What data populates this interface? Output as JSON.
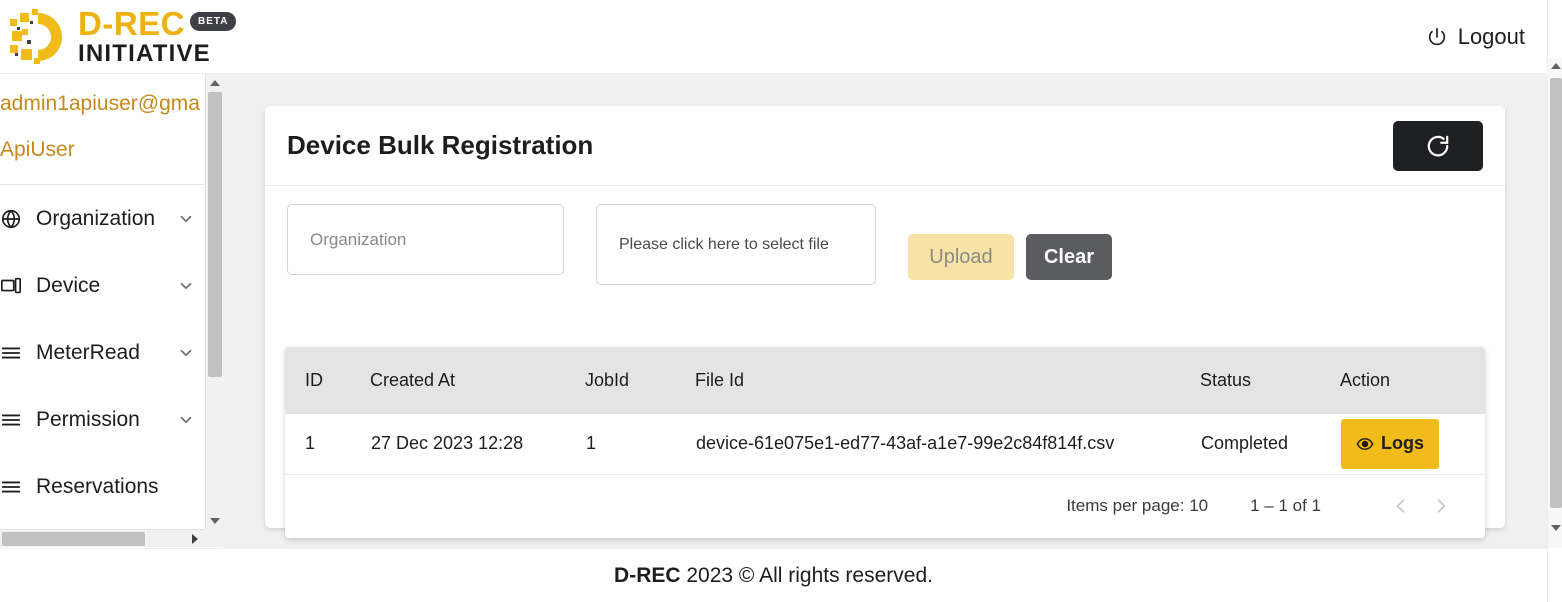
{
  "brand": {
    "title": "D-REC",
    "subtitle": "INITIATIVE",
    "badge": "BETA",
    "logo_icon": "drec-logo-icon"
  },
  "topbar": {
    "logout_label": "Logout",
    "logout_icon": "power-icon"
  },
  "sidebar": {
    "user_email": "admin1apiuser@gma",
    "user_role": "ApiUser",
    "items": [
      {
        "label": "Organization",
        "icon": "organization-icon",
        "chevron": "chevron-down-icon"
      },
      {
        "label": "Device",
        "icon": "device-icon",
        "chevron": "chevron-down-icon"
      },
      {
        "label": "MeterRead",
        "icon": "list-icon",
        "chevron": "chevron-down-icon"
      },
      {
        "label": "Permission",
        "icon": "list-icon",
        "chevron": "chevron-down-icon"
      },
      {
        "label": "Reservations",
        "icon": "list-icon",
        "chevron": "chevron-down-icon"
      }
    ]
  },
  "main": {
    "page_title": "Device Bulk Registration",
    "refresh_icon": "refresh-icon",
    "form": {
      "organization_value": "",
      "organization_placeholder": "Organization",
      "file_select_label": "Please click here to select file",
      "upload_label": "Upload",
      "clear_label": "Clear"
    },
    "table": {
      "columns": [
        "ID",
        "Created At",
        "JobId",
        "File Id",
        "",
        "Status",
        "Action"
      ],
      "headers": {
        "id": "ID",
        "created_at": "Created At",
        "job_id": "JobId",
        "file_id": "File Id",
        "status": "Status",
        "action": "Action"
      },
      "rows": [
        {
          "id": "1",
          "created_at": "27 Dec 2023 12:28",
          "job_id": "1",
          "file_id": "device-61e075e1-ed77-43af-a1e7-99e2c84f814f.csv",
          "status": "Completed",
          "action_label": "Logs",
          "action_icon": "eye-icon"
        }
      ]
    },
    "paginator": {
      "items_per_page_label": "Items per page:",
      "items_per_page_value": "10",
      "range_label": "1 – 1 of 1",
      "prev_icon": "chevron-left-icon",
      "next_icon": "chevron-right-icon"
    }
  },
  "footer": {
    "brand": "D-REC",
    "text": " 2023 © All rights reserved."
  },
  "colors": {
    "brand_yellow": "#eeb111",
    "accent_yellow": "#f0bb1b",
    "upload_disabled": "#f7e3a6",
    "clear_gray": "#5a5c60",
    "dark": "#1f2023",
    "user_text": "#c8891a",
    "table_header_bg": "#e4e4e4",
    "page_bg": "#f0f0f0"
  }
}
